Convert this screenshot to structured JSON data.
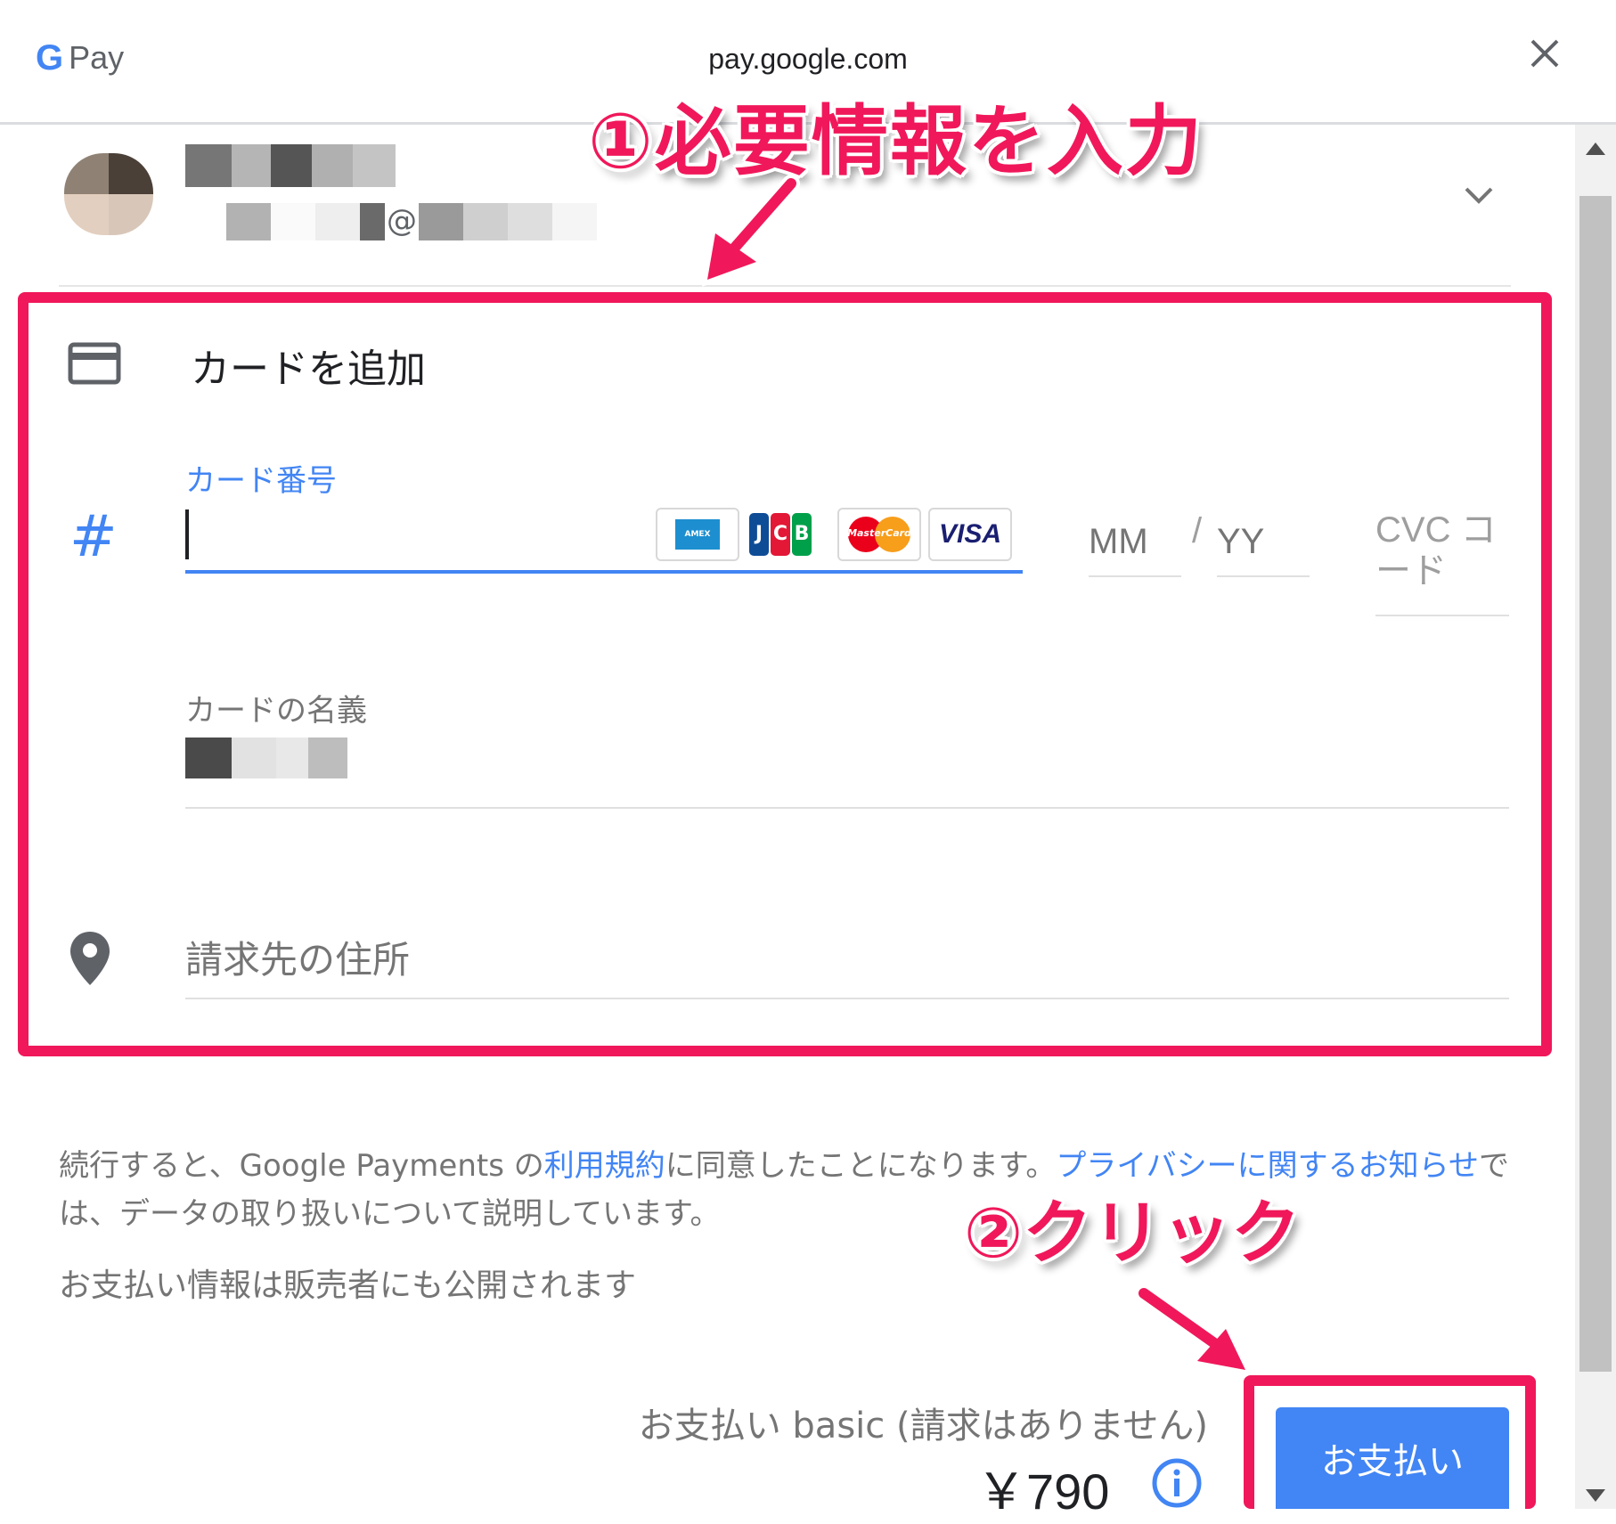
{
  "header": {
    "logo_g": "G",
    "logo_pay": "Pay",
    "url": "pay.google.com",
    "close_icon": "close-icon"
  },
  "account": {
    "email_at": "@",
    "chevron_icon": "chevron-down-icon"
  },
  "form": {
    "title": "カードを追加",
    "card_number_label": "カード番号",
    "card_number_icon": "#",
    "card_brands": [
      "AMEX",
      "JCB",
      "MasterCard",
      "VISA"
    ],
    "mm_placeholder": "MM",
    "separator": "/",
    "yy_placeholder": "YY",
    "cvc_placeholder": "CVC コード",
    "name_label": "カードの名義",
    "address_placeholder": "請求先の住所"
  },
  "annotations": {
    "step1": "①必要情報を入力",
    "step2": "②クリック",
    "color": "#f0185a"
  },
  "footer": {
    "terms_prefix": "続行すると、Google Payments の",
    "terms_link": "利用規約",
    "terms_middle": "に同意したことになります。",
    "privacy_link": "プライバシーに関するお知らせ",
    "terms_suffix": "では、データの取り扱いについて説明しています。",
    "disclosure": "お支払い情報は販売者にも公開されます",
    "plan": "お支払い basic (請求はありません)",
    "price": "￥790",
    "pay_button": "お支払い"
  },
  "colors": {
    "accent": "#4285f4",
    "highlight": "#f0185a"
  }
}
